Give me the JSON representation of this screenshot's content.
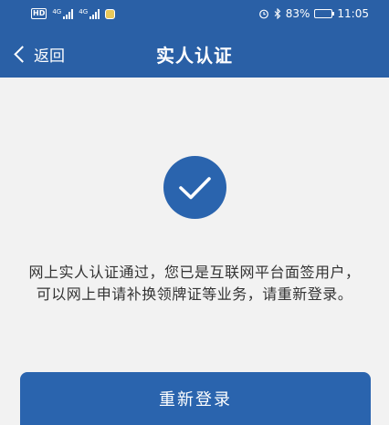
{
  "status_bar": {
    "hd_badge": "HD",
    "network_1": "4G",
    "network_2": "4G",
    "battery_text": "83%",
    "battery_level": 0.83,
    "time": "11:05"
  },
  "nav": {
    "back_label": "返回",
    "title": "实人认证"
  },
  "result": {
    "icon": "checkmark-icon",
    "message": "网上实人认证通过，您已是互联网平台面签用户，可以网上申请补换领牌证等业务，请重新登录。"
  },
  "actions": {
    "relogin_label": "重新登录"
  },
  "colors": {
    "primary": "#2a60a6",
    "background": "#f2f2f2",
    "text": "#333333"
  }
}
